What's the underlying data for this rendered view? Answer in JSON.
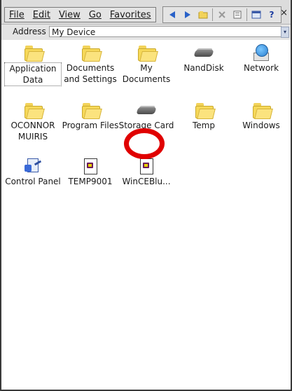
{
  "menu": {
    "items": [
      "File",
      "Edit",
      "View",
      "Go",
      "Favorites"
    ]
  },
  "toolbar": {
    "icons": [
      "back-arrow-icon",
      "forward-arrow-icon",
      "up-folder-icon",
      "delete-icon",
      "properties-icon",
      "view-icon",
      "help-icon"
    ],
    "help_label": "?",
    "close_label": "×"
  },
  "address": {
    "label": "Address",
    "value": "My Device",
    "dropdown_glyph": "▾"
  },
  "items": [
    {
      "label": "Application Data",
      "icon": "folder-icon",
      "selected": true
    },
    {
      "label": "Documents and Settings",
      "icon": "folder-icon"
    },
    {
      "label": "My Documents",
      "icon": "folder-icon"
    },
    {
      "label": "NandDisk",
      "icon": "disk-icon"
    },
    {
      "label": "Network",
      "icon": "network-icon"
    },
    {
      "label": "OCONNOR MUIRIS",
      "icon": "folder-icon"
    },
    {
      "label": "Program Files",
      "icon": "folder-icon"
    },
    {
      "label": "Storage Card",
      "icon": "disk-icon",
      "highlighted": true
    },
    {
      "label": "Temp",
      "icon": "folder-icon"
    },
    {
      "label": "Windows",
      "icon": "folder-icon"
    },
    {
      "label": "Control Panel",
      "icon": "control-panel-icon"
    },
    {
      "label": "TEMP9001",
      "icon": "program-icon"
    },
    {
      "label": "WinCEBlu...",
      "icon": "program-icon"
    }
  ],
  "colors": {
    "annotation_ring": "#e00000",
    "folder": "#f6d858"
  }
}
